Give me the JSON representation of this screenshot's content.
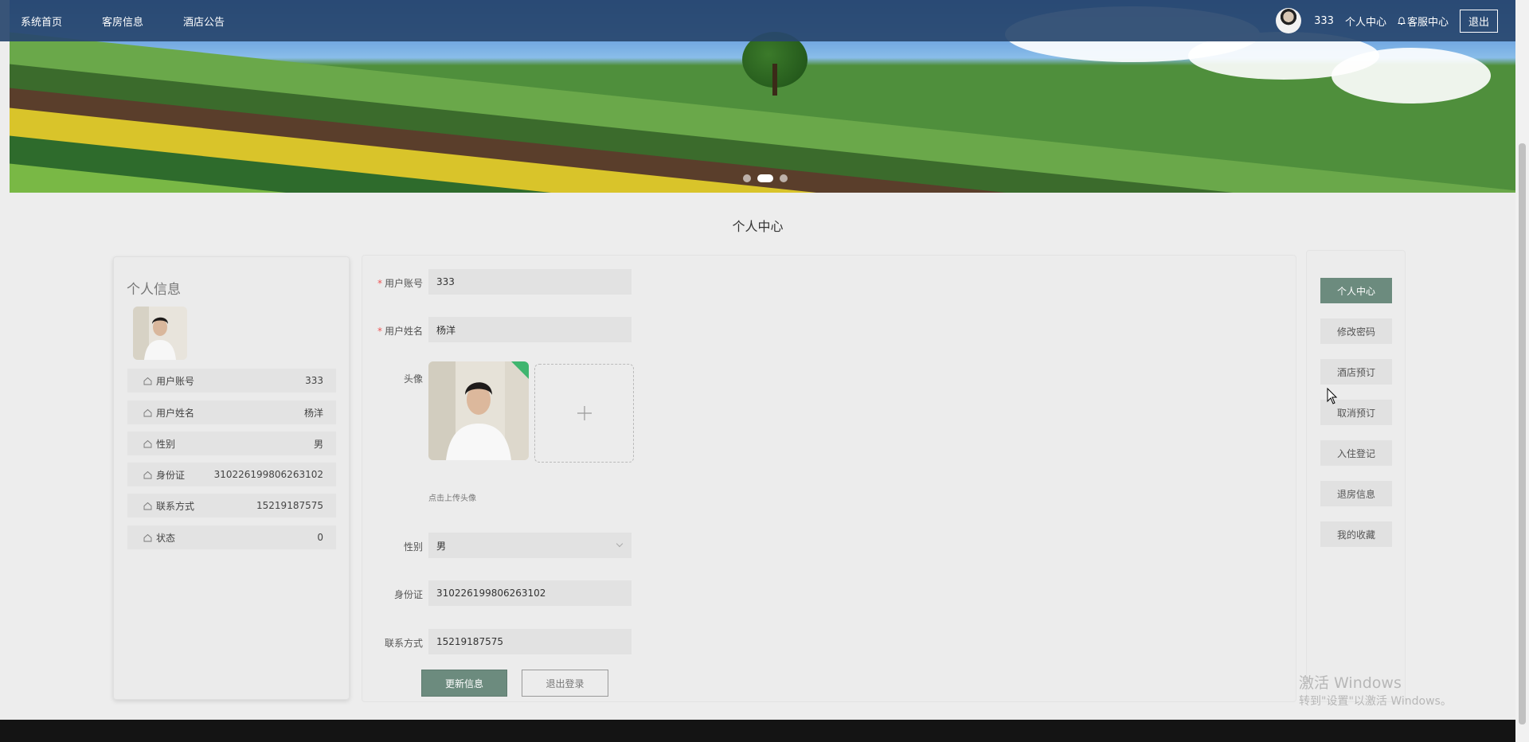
{
  "nav": {
    "links": [
      "系统首页",
      "客房信息",
      "酒店公告"
    ],
    "username": "333",
    "personal_center": "个人中心",
    "service_center": "客服中心",
    "logout": "退出"
  },
  "page_title": "个人中心",
  "profile": {
    "title": "个人信息",
    "rows": [
      {
        "label": "用户账号",
        "value": "333"
      },
      {
        "label": "用户姓名",
        "value": "杨洋"
      },
      {
        "label": "性别",
        "value": "男"
      },
      {
        "label": "身份证",
        "value": "310226199806263102"
      },
      {
        "label": "联系方式",
        "value": "15219187575"
      },
      {
        "label": "状态",
        "value": "0"
      }
    ]
  },
  "form": {
    "account_label": "用户账号",
    "account_value": "333",
    "name_label": "用户姓名",
    "name_value": "杨洋",
    "avatar_label": "头像",
    "upload_tip": "点击上传头像",
    "gender_label": "性别",
    "gender_value": "男",
    "id_label": "身份证",
    "id_value": "310226199806263102",
    "phone_label": "联系方式",
    "phone_value": "15219187575",
    "update_button": "更新信息",
    "logout_button": "退出登录"
  },
  "side_menu": [
    "个人中心",
    "修改密码",
    "酒店预订",
    "取消预订",
    "入住登记",
    "退房信息",
    "我的收藏"
  ],
  "watermark": {
    "line1": "激活 Windows",
    "line2": "转到\"设置\"以激活 Windows。"
  },
  "colors": {
    "accent": "#6c8b7e",
    "nav_bg": "#28466e",
    "success": "#3fb56f"
  }
}
